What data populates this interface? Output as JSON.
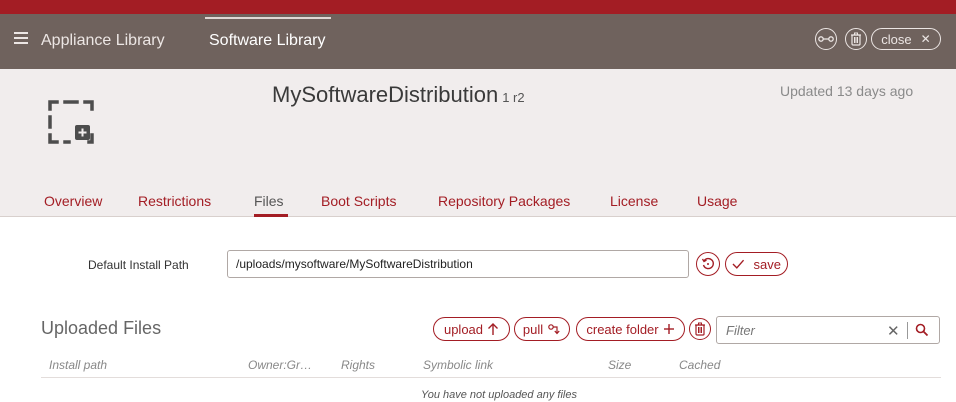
{
  "nav": {
    "tabs": [
      {
        "label": "Appliance Library"
      },
      {
        "label": "Software Library"
      }
    ],
    "close_label": "close",
    "close_glyph": "✕"
  },
  "colors": {
    "brand_red": "#a31d24",
    "nav_bg": "#6f625d",
    "header_bg": "#f1eded"
  },
  "software": {
    "name": "MySoftwareDistribution",
    "version": "1 r2",
    "updated": "Updated 13 days ago",
    "icon": "placeholder-add-icon"
  },
  "subtabs": [
    {
      "label": "Overview"
    },
    {
      "label": "Restrictions"
    },
    {
      "label": "Files"
    },
    {
      "label": "Boot Scripts"
    },
    {
      "label": "Repository Packages"
    },
    {
      "label": "License"
    },
    {
      "label": "Usage"
    }
  ],
  "install_path": {
    "label": "Default Install Path",
    "value": "/uploads/mysoftware/MySoftwareDistribution",
    "save_label": "save"
  },
  "files": {
    "title": "Uploaded Files",
    "upload_label": "upload",
    "pull_label": "pull",
    "create_folder_label": "create folder",
    "filter_placeholder": "Filter",
    "clear_glyph": "✕",
    "columns": [
      "Install path",
      "Owner:Gr…",
      "Rights",
      "Symbolic link",
      "Size",
      "Cached"
    ],
    "empty_message": "You have not uploaded any files"
  }
}
